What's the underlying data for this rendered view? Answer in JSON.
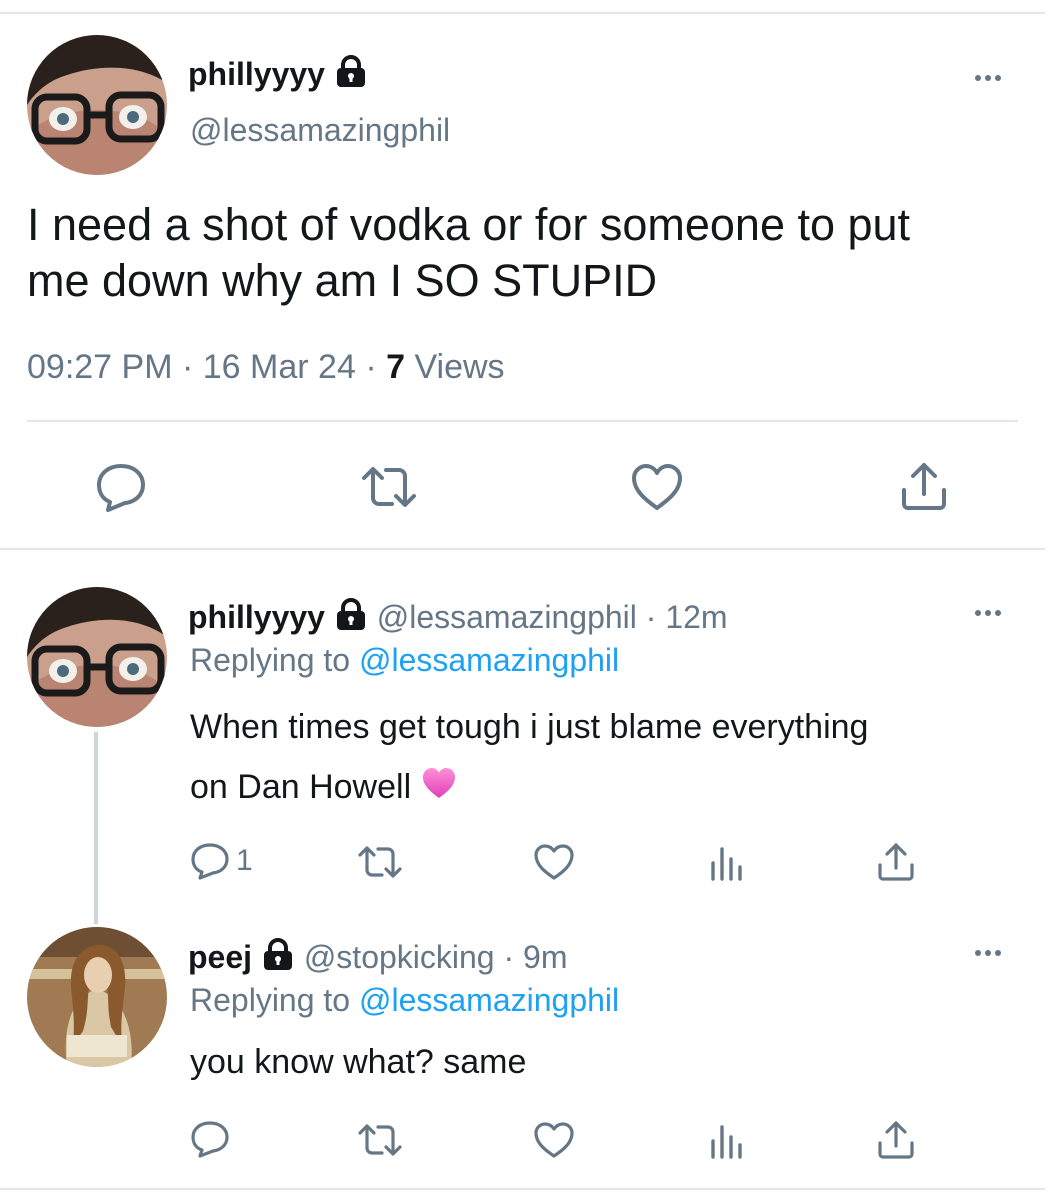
{
  "main_tweet": {
    "display_name": "phillyyyy",
    "handle": "@lessamazingphil",
    "text_line1": "I need a shot of vodka or for someone to put",
    "text_line2": "me down why am I SO STUPID",
    "time": "09:27 PM",
    "date": "16 Mar 24",
    "views_count": "7",
    "views_label": "Views"
  },
  "replies": [
    {
      "display_name": "phillyyyy",
      "handle": "@lessamazingphil",
      "age": "12m",
      "replying_prefix": "Replying to",
      "replying_to": "@lessamazingphil",
      "text_line1": "When times get tough i just blame everything",
      "text_line2": "on Dan Howell",
      "emoji": "pink-heart",
      "reply_count": "1"
    },
    {
      "display_name": "peej",
      "handle": "@stopkicking",
      "age": "9m",
      "replying_prefix": "Replying to",
      "replying_to": "@lessamazingphil",
      "text_line1": "you know what? same"
    }
  ],
  "separator": "·",
  "icons": [
    "lock-icon",
    "more-icon",
    "reply-icon",
    "retweet-icon",
    "like-icon",
    "share-icon",
    "analytics-icon"
  ],
  "colors": {
    "link": "#1da1f2",
    "muted": "#657786",
    "text": "#14171a",
    "divider": "#e1e8ed",
    "heart": "#f45fc8"
  }
}
